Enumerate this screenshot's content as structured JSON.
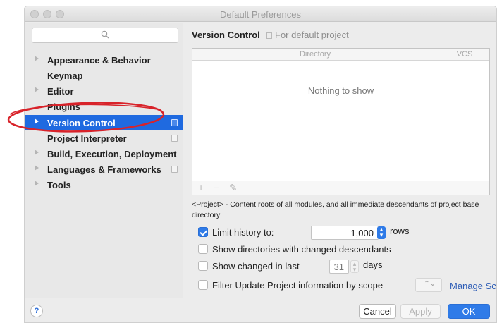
{
  "window": {
    "title": "Default Preferences"
  },
  "sidebar": {
    "search_placeholder": "",
    "items": [
      {
        "label": "Appearance & Behavior",
        "expandable": true,
        "project_icon": false,
        "selected": false
      },
      {
        "label": "Keymap",
        "expandable": false,
        "project_icon": false,
        "selected": false
      },
      {
        "label": "Editor",
        "expandable": true,
        "project_icon": false,
        "selected": false
      },
      {
        "label": "Plugins",
        "expandable": false,
        "project_icon": false,
        "selected": false
      },
      {
        "label": "Version Control",
        "expandable": true,
        "project_icon": true,
        "selected": true
      },
      {
        "label": "Project Interpreter",
        "expandable": false,
        "project_icon": true,
        "selected": false
      },
      {
        "label": "Build, Execution, Deployment",
        "expandable": true,
        "project_icon": false,
        "selected": false
      },
      {
        "label": "Languages & Frameworks",
        "expandable": true,
        "project_icon": true,
        "selected": false
      },
      {
        "label": "Tools",
        "expandable": true,
        "project_icon": false,
        "selected": false
      }
    ]
  },
  "main": {
    "title": "Version Control",
    "subtitle": "For default project",
    "table": {
      "columns": [
        "Directory",
        "VCS"
      ],
      "empty_text": "Nothing to show",
      "toolbar": [
        "+",
        "−",
        "✎"
      ]
    },
    "description": "<Project> - Content roots of all modules, and all immediate descendants of project base directory",
    "options": {
      "limit_history": {
        "label": "Limit history to:",
        "checked": true,
        "value": "1,000",
        "suffix": "rows"
      },
      "show_dirs": {
        "label": "Show directories with changed descendants",
        "checked": false
      },
      "show_changed": {
        "label": "Show changed in last",
        "checked": false,
        "value": "31",
        "suffix": "days"
      },
      "filter_update": {
        "label": "Filter Update Project information by scope",
        "checked": false,
        "link": "Manage Scopes"
      }
    }
  },
  "footer": {
    "help": "?",
    "cancel": "Cancel",
    "apply": "Apply",
    "ok": "OK"
  },
  "colors": {
    "accent": "#2f7be8",
    "selection": "#1f6ae0",
    "annotation": "#d8232a"
  }
}
